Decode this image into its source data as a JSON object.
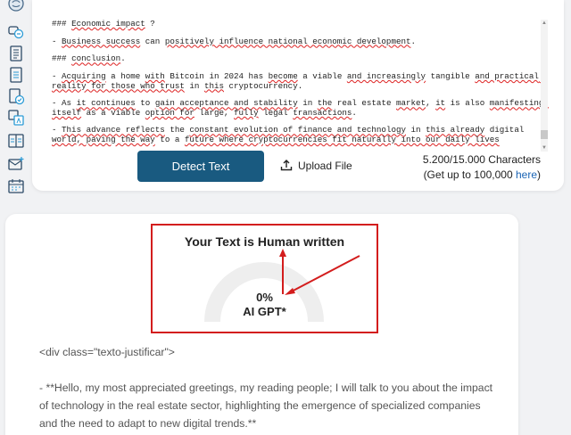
{
  "sidebar": {
    "items": [
      {
        "icon": "brain-icon"
      },
      {
        "icon": "paraphrase-icon"
      },
      {
        "icon": "document-icon"
      },
      {
        "icon": "text-document-icon"
      },
      {
        "icon": "document-check-icon"
      },
      {
        "icon": "translate-icon"
      },
      {
        "icon": "compare-icon"
      },
      {
        "icon": "email-icon"
      },
      {
        "icon": "calendar-icon"
      }
    ]
  },
  "editor": {
    "lines": [
      {
        "segments": [
          {
            "t": "### "
          },
          {
            "t": "Economic impact",
            "sq": true
          },
          {
            "t": " ?"
          }
        ]
      },
      {
        "segments": [
          {
            "t": "- "
          },
          {
            "t": "Business success",
            "sq": true
          },
          {
            "t": " can "
          },
          {
            "t": "positively influence national economic development",
            "sq": true
          },
          {
            "t": "."
          }
        ]
      },
      {
        "segments": [
          {
            "t": "### "
          },
          {
            "t": "conclusion",
            "sq": true
          },
          {
            "t": "."
          }
        ]
      },
      {
        "segments": [
          {
            "t": "- "
          },
          {
            "t": "Acquiring",
            "sq": true
          },
          {
            "t": " a home "
          },
          {
            "t": "with",
            "sq": true
          },
          {
            "t": " Bitcoin in 2024 has "
          },
          {
            "t": "become",
            "sq": true
          },
          {
            "t": " a viable "
          },
          {
            "t": "and increasingly",
            "sq": true
          },
          {
            "t": " tangible "
          },
          {
            "t": "and practical reality for those who trust",
            "sq": true
          },
          {
            "t": " in "
          },
          {
            "t": "this",
            "sq": true
          },
          {
            "t": " cryptocurrency."
          }
        ]
      },
      {
        "segments": [
          {
            "t": "- As "
          },
          {
            "t": "it continues",
            "sq": true
          },
          {
            "t": " to "
          },
          {
            "t": "gain acceptance and stability",
            "sq": true
          },
          {
            "t": " in "
          },
          {
            "t": "the",
            "sq": true
          },
          {
            "t": " real estate "
          },
          {
            "t": "market",
            "sq": true
          },
          {
            "t": ", "
          },
          {
            "t": "it",
            "sq": true
          },
          {
            "t": " is also "
          },
          {
            "t": "manifesting itself",
            "sq": true
          },
          {
            "t": " as a viable "
          },
          {
            "t": "option for",
            "sq": true
          },
          {
            "t": " large, "
          },
          {
            "t": "fully",
            "sq": true
          },
          {
            "t": " legal "
          },
          {
            "t": "transactions",
            "sq": true
          },
          {
            "t": "."
          }
        ]
      },
      {
        "segments": [
          {
            "t": "- "
          },
          {
            "t": "This advance reflects",
            "sq": true
          },
          {
            "t": " the "
          },
          {
            "t": "constant evolution of finance and technology",
            "sq": true
          },
          {
            "t": " in "
          },
          {
            "t": "this already",
            "sq": true
          },
          {
            "t": " digital "
          },
          {
            "t": "world, paving the way",
            "sq": true
          },
          {
            "t": " to a "
          },
          {
            "t": "future where cryptocurrencies fit naturally into our daily lives",
            "sq": true
          }
        ]
      }
    ]
  },
  "actions": {
    "detect_label": "Detect Text",
    "upload_label": "Upload File",
    "char_count": "5.200/15.000 Characters",
    "upgrade_prefix": "(Get up to 100,000 ",
    "upgrade_link": "here",
    "upgrade_suffix": ")"
  },
  "result": {
    "title": "Your Text is Human written",
    "percent": "0%",
    "label": "AI GPT*",
    "ai_fraction": 0,
    "colors": {
      "highlight": "#d31d1d",
      "gauge_track": "#eeeeee",
      "button": "#195a80"
    },
    "paragraphs": [
      "<div class=\"texto-justificar\">",
      "- **Hello, my most appreciated greetings, my reading people; I will talk to you about the impact of technology in the real estate sector, highlighting the emergence of specialized companies and the need to adapt to new digital trends.**"
    ]
  }
}
